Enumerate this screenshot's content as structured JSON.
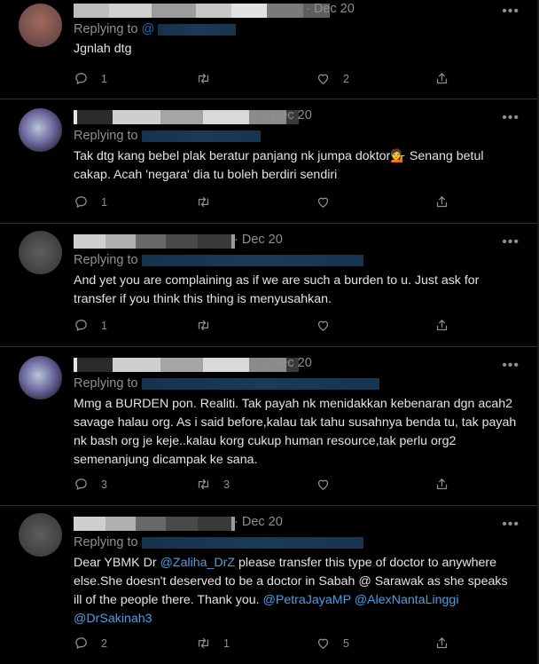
{
  "tweets": [
    {
      "date": "Dec 20",
      "replying_prefix": "Replying to",
      "replying_visible": "@",
      "text": "Jgnlah dtg",
      "replies": "1",
      "retweets": "",
      "likes": "2"
    },
    {
      "date": "Dec 20",
      "replying_prefix": "Replying to",
      "text": "Tak dtg kang bebel plak beratur panjang nk jumpa doktor💁 Senang betul cakap. Acah 'negara' dia tu boleh berdiri sendiri",
      "replies": "1",
      "retweets": "",
      "likes": ""
    },
    {
      "date": "Dec 20",
      "replying_prefix": "Replying to",
      "text": "And yet you are complaining as if we are such a burden to u. Just ask for transfer if you think this thing is menyusahkan.",
      "replies": "1",
      "retweets": "",
      "likes": ""
    },
    {
      "date": "Dec 20",
      "replying_prefix": "Replying to",
      "text": "Mmg a BURDEN pon. Realiti. Tak payah nk menidakkan kebenaran dgn acah2 savage halau org. As i said before,kalau tak tahu susahnya benda tu, tak payah nk bash org je keje..kalau korg cukup human resource,tak perlu org2 semenanjung dicampak ke sana.",
      "replies": "3",
      "retweets": "3",
      "likes": ""
    },
    {
      "date": "Dec 20",
      "replying_prefix": "Replying to",
      "text_before": "Dear YBMK Dr ",
      "mention1": "@Zaliha_DrZ",
      "text_middle": " please transfer this type of doctor to anywhere else.She doesn't deserved to be a doctor in Sabah @ Sarawak as she speaks ill of the people there. Thank you. ",
      "mention2": "@PetraJayaMP",
      "mention3": "@AlexNantaLinggi",
      "mention4": "@DrSakinah3",
      "replies": "2",
      "retweets": "1",
      "likes": "5"
    }
  ],
  "icons": {
    "more": "more-icon",
    "reply": "reply-icon",
    "retweet": "retweet-icon",
    "like": "heart-icon",
    "share": "share-icon"
  },
  "colors": {
    "background": "#000000",
    "text": "#e3e3e3",
    "muted": "#8b9096",
    "mention": "#4a9ee6",
    "divider": "#2f3336"
  }
}
